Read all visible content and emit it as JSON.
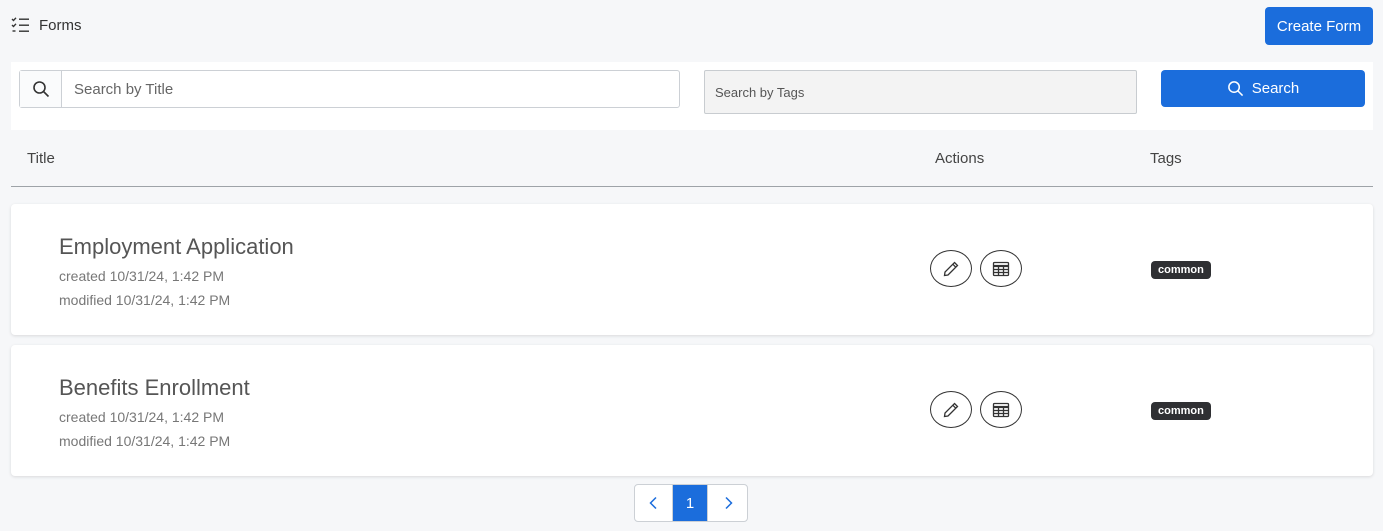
{
  "header": {
    "title": "Forms",
    "create_label": "Create Form"
  },
  "search": {
    "title_placeholder": "Search by Title",
    "tags_placeholder": "Search by Tags",
    "button_label": "Search"
  },
  "table": {
    "columns": [
      "Title",
      "Actions",
      "Tags"
    ],
    "rows": [
      {
        "title": "Employment Application",
        "created": "created 10/31/24, 1:42 PM",
        "modified": "modified 10/31/24, 1:42 PM",
        "tags": [
          "common"
        ]
      },
      {
        "title": "Benefits Enrollment",
        "created": "created 10/31/24, 1:42 PM",
        "modified": "modified 10/31/24, 1:42 PM",
        "tags": [
          "common"
        ]
      }
    ]
  },
  "pagination": {
    "current_page": "1"
  },
  "icons": {
    "header": "checklist-icon",
    "search": "search-icon",
    "edit": "pencil-icon",
    "submissions": "table-grid-icon",
    "prev": "chevron-left-icon",
    "next": "chevron-right-icon"
  },
  "colors": {
    "primary": "#1b6ddc",
    "tag_bg": "#2f3033",
    "page_bg": "#f6f7f9"
  }
}
